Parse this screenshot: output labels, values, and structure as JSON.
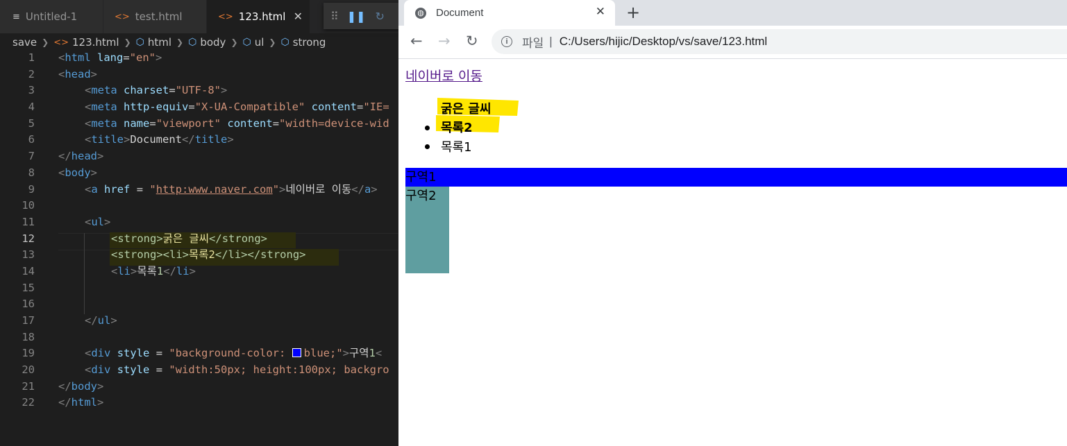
{
  "editor": {
    "tabs": [
      {
        "label": "Untitled-1",
        "icon": "lines-icon"
      },
      {
        "label": "test.html",
        "icon": "html-brackets-icon"
      },
      {
        "label": "123.html",
        "icon": "html-brackets-icon",
        "active": true
      }
    ],
    "debug_icons": [
      "grip-icon",
      "pause-icon",
      "step-over-icon"
    ],
    "breadcrumb": [
      "save",
      "123.html",
      "html",
      "body",
      "ul",
      "strong"
    ],
    "line_numbers": [
      "1",
      "2",
      "3",
      "4",
      "5",
      "6",
      "7",
      "8",
      "9",
      "10",
      "11",
      "12",
      "13",
      "14",
      "15",
      "16",
      "17",
      "18",
      "19",
      "20",
      "21",
      "22"
    ],
    "current_line": "12",
    "code": {
      "l1": [
        "<",
        "html",
        " ",
        "lang",
        "=",
        "\"en\"",
        ">"
      ],
      "l2": [
        "<",
        "head",
        ">"
      ],
      "l3": [
        "<",
        "meta",
        " ",
        "charset",
        "=",
        "\"UTF-8\"",
        ">"
      ],
      "l4": [
        "<",
        "meta",
        " ",
        "http-equiv",
        "=",
        "\"X-UA-Compatible\"",
        " ",
        "content",
        "=",
        "\"IE="
      ],
      "l5": [
        "<",
        "meta",
        " ",
        "name",
        "=",
        "\"viewport\"",
        " ",
        "content",
        "=",
        "\"width=device-wid"
      ],
      "l6": [
        "<",
        "title",
        ">",
        "Document",
        "</",
        "title",
        ">"
      ],
      "l7": [
        "</",
        "head",
        ">"
      ],
      "l8": [
        "<",
        "body",
        ">"
      ],
      "l9": [
        "<",
        "a",
        " ",
        "href",
        " = ",
        "\"",
        "http:www.naver.com",
        "\"",
        ">",
        "네이버로 이동",
        "</",
        "a",
        ">"
      ],
      "l11": [
        "<",
        "ul",
        ">"
      ],
      "l12": [
        "<strong>",
        "굵은 글씨",
        "</strong>"
      ],
      "l13": [
        "<strong><li>",
        "목록",
        "2",
        "</li></strong>"
      ],
      "l14": [
        "<",
        "li",
        ">",
        "목록",
        "1",
        "</",
        "li",
        ">"
      ],
      "l17": [
        "</",
        "ul",
        ">"
      ],
      "l19": [
        "<",
        "div",
        " ",
        "style",
        " = ",
        "\"background-color: ",
        "blue;\"",
        ">",
        "구역",
        "1",
        "<"
      ],
      "l20": [
        "<",
        "div",
        " ",
        "style",
        " = ",
        "\"width:50px; height:100px; backgro"
      ],
      "l21": [
        "</",
        "body",
        ">"
      ],
      "l22": [
        "</",
        "html",
        ">"
      ]
    }
  },
  "browser": {
    "tab_title": "Document",
    "address_scheme": "파일",
    "address_url": "C:/Users/hijic/Desktop/vs/save/123.html",
    "page": {
      "link_text": "네이버로 이동",
      "strong_text": "굵은 글씨",
      "list_items": [
        "목록2",
        "목록1"
      ],
      "div1_text": "구역1",
      "div2_text": "구역2"
    },
    "colors": {
      "div1_bg": "#0000ff",
      "div2_bg": "#5f9ea0",
      "highlight": "#ffe600"
    }
  }
}
